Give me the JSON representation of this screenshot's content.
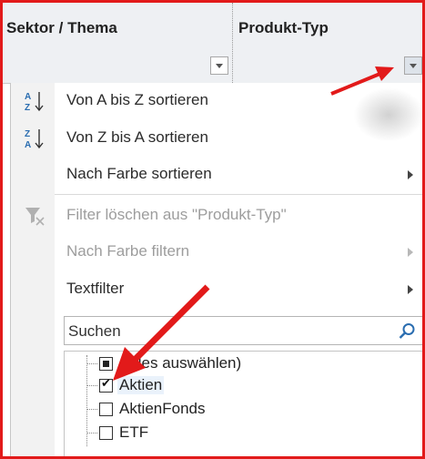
{
  "colors": {
    "frame": "#e21a1a",
    "annotation": "#e21a1a",
    "header_bg": "#eef0f3",
    "disabled_text": "#9d9d9d"
  },
  "columns": [
    {
      "label": "Sektor / Thema",
      "icon": "chevron-down-icon"
    },
    {
      "label": "Produkt-Typ",
      "icon": "chevron-down-icon"
    }
  ],
  "menu": {
    "sort_asc": "Von A bis Z sortieren",
    "sort_desc": "Von Z bis A sortieren",
    "sort_color": "Nach Farbe sortieren",
    "clear_filter": "Filter löschen aus \"Produkt-Typ\"",
    "filter_color": "Nach Farbe filtern",
    "text_filter": "Textfilter"
  },
  "search": {
    "placeholder": "Suchen",
    "icon": "search-icon"
  },
  "values": [
    {
      "label": "(Alles auswählen)",
      "state": "partial"
    },
    {
      "label": "Aktien",
      "state": "checked"
    },
    {
      "label": "AktienFonds",
      "state": "unchecked"
    },
    {
      "label": "ETF",
      "state": "unchecked"
    }
  ]
}
